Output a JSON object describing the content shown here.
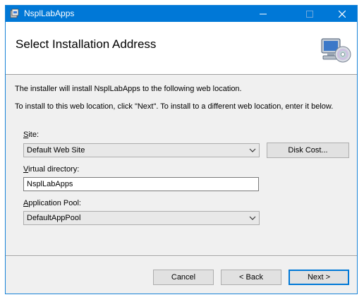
{
  "window": {
    "title": "NsplLabApps",
    "controls": {
      "minimize": "–",
      "maximize": "☐",
      "close": "✕"
    },
    "accent_color": "#0078d7"
  },
  "header": {
    "title": "Select Installation Address",
    "icon": "computer-cd-icon"
  },
  "body": {
    "line1": "The installer will install NsplLabApps to the following web location.",
    "line2": "To install to this web location, click \"Next\". To install to a different web location, enter it below."
  },
  "site": {
    "label_accel": "S",
    "label_rest": "ite:",
    "value": "Default Web Site"
  },
  "virtual_dir": {
    "label_accel": "V",
    "label_rest": "irtual directory:",
    "value": "NsplLabApps"
  },
  "app_pool": {
    "label_accel": "A",
    "label_rest": "pplication Pool:",
    "value": "DefaultAppPool"
  },
  "buttons": {
    "disk_cost": "Disk Cost...",
    "cancel": "Cancel",
    "back": "< Back",
    "next": "Next >"
  }
}
